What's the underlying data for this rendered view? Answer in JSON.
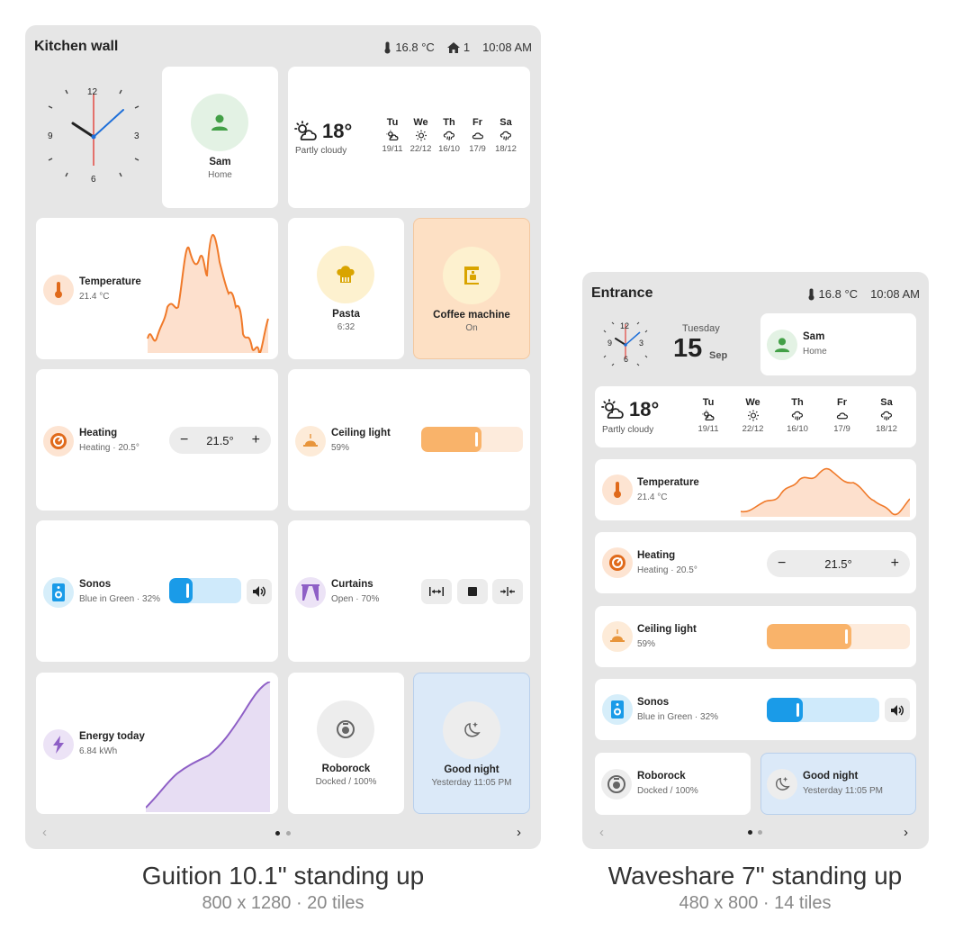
{
  "screens": {
    "left": {
      "header": {
        "title": "Kitchen wall",
        "temp": "16.8 °C",
        "home_count": "1",
        "time": "10:08 AM"
      },
      "person": {
        "name": "Sam",
        "status": "Home"
      },
      "weather": {
        "temp": "18°",
        "desc": "Partly cloudy",
        "forecast": [
          {
            "day": "Tu",
            "temps": "19/11",
            "icon": "partly-cloudy-icon"
          },
          {
            "day": "We",
            "temps": "22/12",
            "icon": "sun-icon"
          },
          {
            "day": "Th",
            "temps": "16/10",
            "icon": "rain-icon"
          },
          {
            "day": "Fr",
            "temps": "17/9",
            "icon": "cloud-icon"
          },
          {
            "day": "Sa",
            "temps": "18/12",
            "icon": "rain-icon"
          }
        ]
      },
      "temperature": {
        "title": "Temperature",
        "value": "21.4 °C"
      },
      "pasta": {
        "title": "Pasta",
        "value": "6:32"
      },
      "coffee": {
        "title": "Coffee machine",
        "value": "On"
      },
      "heating": {
        "title": "Heating",
        "value": "Heating · 20.5°",
        "setpoint": "21.5°",
        "minus": "−",
        "plus": "+"
      },
      "ceiling": {
        "title": "Ceiling light",
        "value": "59%",
        "level": 0.59
      },
      "sonos": {
        "title": "Sonos",
        "value": "Blue in Green · 32%",
        "level": 0.32
      },
      "curtains": {
        "title": "Curtains",
        "value": "Open · 70%"
      },
      "energy": {
        "title": "Energy today",
        "value": "6.84 kWh"
      },
      "roborock": {
        "title": "Roborock",
        "value": "Docked / 100%"
      },
      "goodnight": {
        "title": "Good night",
        "value": "Yesterday 11:05 PM"
      },
      "clock_numbers": {
        "n12": "12",
        "n3": "3",
        "n6": "6",
        "n9": "9"
      },
      "pager": {
        "prev": "‹",
        "next": "›"
      }
    },
    "right": {
      "header": {
        "title": "Entrance",
        "temp": "16.8 °C",
        "time": "10:08 AM"
      },
      "date": {
        "weekday": "Tuesday",
        "day": "15",
        "month": "Sep"
      },
      "person": {
        "name": "Sam",
        "status": "Home"
      },
      "weather": {
        "temp": "18°",
        "desc": "Partly cloudy",
        "forecast": [
          {
            "day": "Tu",
            "temps": "19/11",
            "icon": "partly-cloudy-icon"
          },
          {
            "day": "We",
            "temps": "22/12",
            "icon": "sun-icon"
          },
          {
            "day": "Th",
            "temps": "16/10",
            "icon": "rain-icon"
          },
          {
            "day": "Fr",
            "temps": "17/9",
            "icon": "cloud-icon"
          },
          {
            "day": "Sa",
            "temps": "18/12",
            "icon": "rain-icon"
          }
        ]
      },
      "temperature": {
        "title": "Temperature",
        "value": "21.4 °C"
      },
      "heating": {
        "title": "Heating",
        "value": "Heating · 20.5°",
        "setpoint": "21.5°",
        "minus": "−",
        "plus": "+"
      },
      "ceiling": {
        "title": "Ceiling light",
        "value": "59%",
        "level": 0.59
      },
      "sonos": {
        "title": "Sonos",
        "value": "Blue in Green · 32%",
        "level": 0.32
      },
      "roborock": {
        "title": "Roborock",
        "value": "Docked / 100%"
      },
      "goodnight": {
        "title": "Good night",
        "value": "Yesterday 11:05 PM"
      },
      "clock_numbers": {
        "n12": "12",
        "n3": "3",
        "n6": "6",
        "n9": "9"
      },
      "pager": {
        "prev": "‹",
        "next": "›"
      }
    }
  },
  "captions": {
    "left": {
      "main": "Guition 10.1\" standing up",
      "sub": "800 x 1280 · 20 tiles"
    },
    "right": {
      "main": "Waveshare 7\" standing up",
      "sub": "480 x 800 · 14 tiles"
    }
  },
  "colors": {
    "orange": "#e06a1b",
    "amber": "#f6a04d",
    "blue": "#1a9be8",
    "purple": "#8e5fc6",
    "coffee_bg": "#fde0c4",
    "night_bg": "#dbe9f8"
  }
}
